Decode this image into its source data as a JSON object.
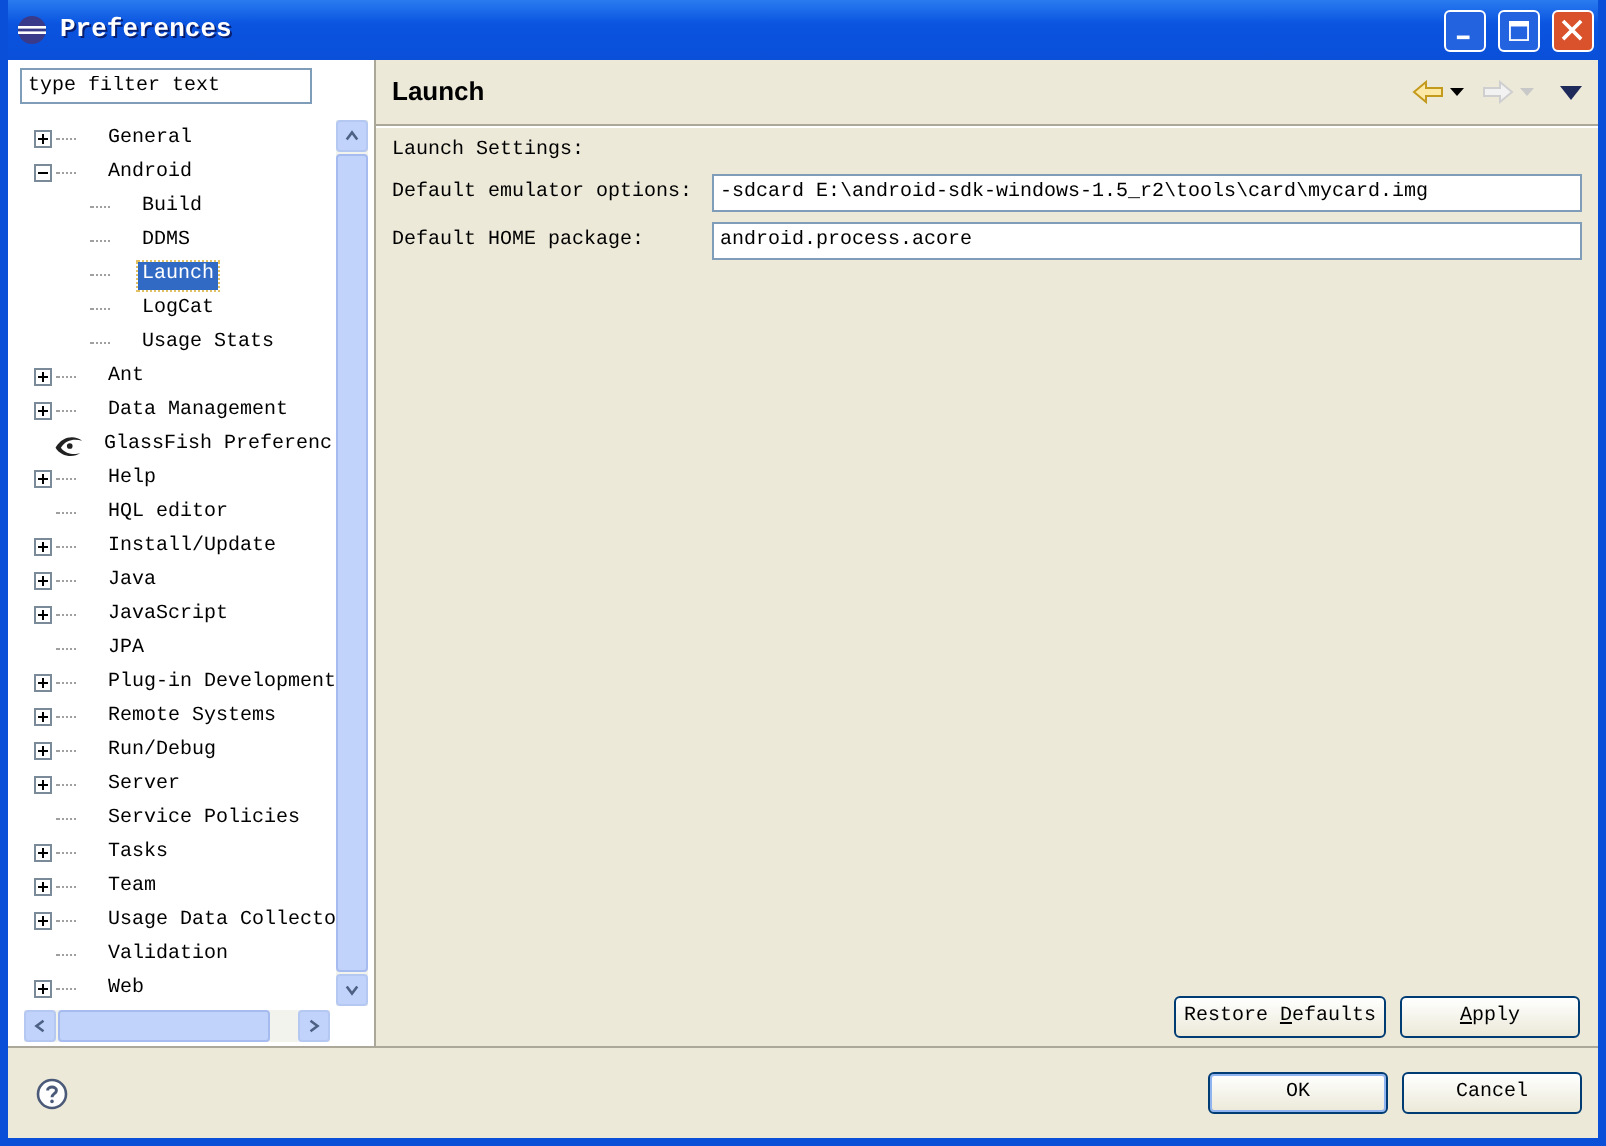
{
  "window": {
    "title": "Preferences"
  },
  "filter": {
    "placeholder": "type filter text"
  },
  "tree": [
    {
      "label": "General",
      "kind": "group",
      "expanded": false,
      "selected": false
    },
    {
      "label": "Android",
      "kind": "group",
      "expanded": true,
      "selected": false,
      "children": [
        {
          "label": "Build",
          "kind": "leaf",
          "selected": false
        },
        {
          "label": "DDMS",
          "kind": "leaf",
          "selected": false
        },
        {
          "label": "Launch",
          "kind": "leaf",
          "selected": true
        },
        {
          "label": "LogCat",
          "kind": "leaf",
          "selected": false
        },
        {
          "label": "Usage Stats",
          "kind": "leaf",
          "selected": false
        }
      ]
    },
    {
      "label": "Ant",
      "kind": "group",
      "expanded": false,
      "selected": false
    },
    {
      "label": "Data Management",
      "kind": "group",
      "expanded": false,
      "selected": false
    },
    {
      "label": "GlassFish Preferenc",
      "kind": "branded",
      "selected": false
    },
    {
      "label": "Help",
      "kind": "group",
      "expanded": false,
      "selected": false
    },
    {
      "label": "HQL editor",
      "kind": "leaf",
      "selected": false
    },
    {
      "label": "Install/Update",
      "kind": "group",
      "expanded": false,
      "selected": false
    },
    {
      "label": "Java",
      "kind": "group",
      "expanded": false,
      "selected": false
    },
    {
      "label": "JavaScript",
      "kind": "group",
      "expanded": false,
      "selected": false
    },
    {
      "label": "JPA",
      "kind": "leaf",
      "selected": false
    },
    {
      "label": "Plug-in Development",
      "kind": "group",
      "expanded": false,
      "selected": false
    },
    {
      "label": "Remote Systems",
      "kind": "group",
      "expanded": false,
      "selected": false
    },
    {
      "label": "Run/Debug",
      "kind": "group",
      "expanded": false,
      "selected": false
    },
    {
      "label": "Server",
      "kind": "group",
      "expanded": false,
      "selected": false
    },
    {
      "label": "Service Policies",
      "kind": "leaf",
      "selected": false
    },
    {
      "label": "Tasks",
      "kind": "group",
      "expanded": false,
      "selected": false
    },
    {
      "label": "Team",
      "kind": "group",
      "expanded": false,
      "selected": false
    },
    {
      "label": "Usage Data Collecto",
      "kind": "group",
      "expanded": false,
      "selected": false
    },
    {
      "label": "Validation",
      "kind": "leaf",
      "selected": false
    },
    {
      "label": "Web",
      "kind": "group",
      "expanded": false,
      "selected": false
    }
  ],
  "page": {
    "title": "Launch",
    "section": "Launch Settings:",
    "fields": [
      {
        "label": "Default emulator options:",
        "value": "-sdcard E:\\android-sdk-windows-1.5_r2\\tools\\card\\mycard.img"
      },
      {
        "label": "Default HOME package:",
        "value": "android.process.acore"
      }
    ],
    "buttons": [
      "Restore **D**efaults",
      "**A**pply"
    ]
  },
  "footer": {
    "buttons": [
      {
        "label": "OK",
        "default": true
      },
      {
        "label": "Cancel",
        "default": false
      }
    ]
  }
}
